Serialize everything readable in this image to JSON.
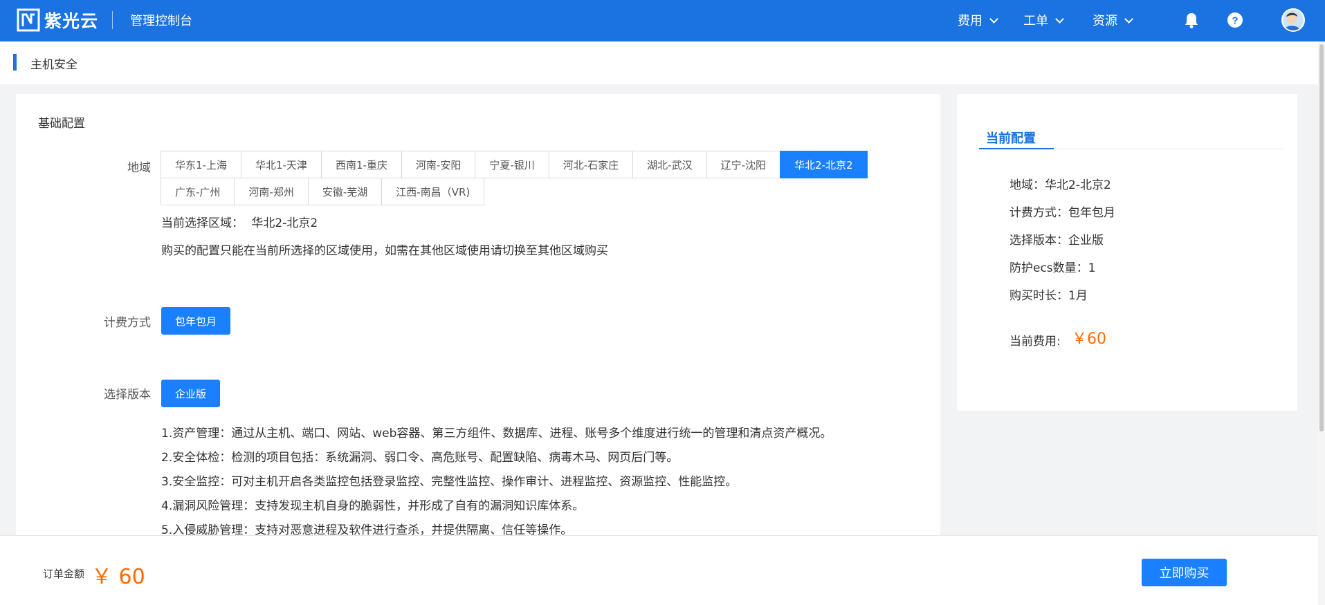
{
  "topbar": {
    "brand": "紫光云",
    "console_title": "管理控制台",
    "menus": [
      "费用",
      "工单",
      "资源"
    ],
    "icons": [
      "bell-icon",
      "help-icon"
    ],
    "accent_color": "#1a73e0"
  },
  "breadcrumb": {
    "title": "主机安全"
  },
  "basic": {
    "section_title": "基础配置",
    "region_label": "地域",
    "regions_row1": [
      "华东1-上海",
      "华北1-天津",
      "西南1-重庆",
      "河南-安阳",
      "宁夏-银川",
      "河北-石家庄",
      "湖北-武汉",
      "辽宁-沈阳",
      "华北2-北京2"
    ],
    "regions_row2": [
      "广东-广州",
      "河南-郑州",
      "安徽-芜湖",
      "江西-南昌（VR)"
    ],
    "selected_region": "华北2-北京2",
    "current_region_label": "当前选择区域：",
    "current_region_value": "华北2-北京2",
    "region_note": "购买的配置只能在当前所选择的区域使用，如需在其他区域使用请切换至其他区域购买",
    "billing_label": "计费方式",
    "billing_option": "包年包月",
    "version_label": "选择版本",
    "version_option": "企业版",
    "features": [
      "1.资产管理：通过从主机、端口、网站、web容器、第三方组件、数据库、进程、账号多个维度进行统一的管理和清点资产概况。",
      "2.安全体检：检测的项目包括：系统漏洞、弱口令、高危账号、配置缺陷、病毒木马、网页后门等。",
      "3.安全监控：可对主机开启各类监控包括登录监控、完整性监控、操作审计、进程监控、资源监控、性能监控。",
      "4.漏洞风险管理：支持发现主机自身的脆弱性，并形成了自有的漏洞知识库体系。",
      "5.入侵威胁管理：支持对恶意进程及软件进行查杀，并提供隔离、信任等操作。"
    ]
  },
  "summary": {
    "tab": "当前配置",
    "items": [
      "地域：华北2-北京2",
      "计费方式：包年包月",
      "选择版本：企业版",
      "防护ecs数量：1",
      "购买时长：1月"
    ],
    "price_label": "当前费用:",
    "price_value": "￥60",
    "price_color": "#ff6a00"
  },
  "bottom": {
    "order_label": "订单金额",
    "order_amount": "￥ 60",
    "buy_label": "立即购买"
  }
}
